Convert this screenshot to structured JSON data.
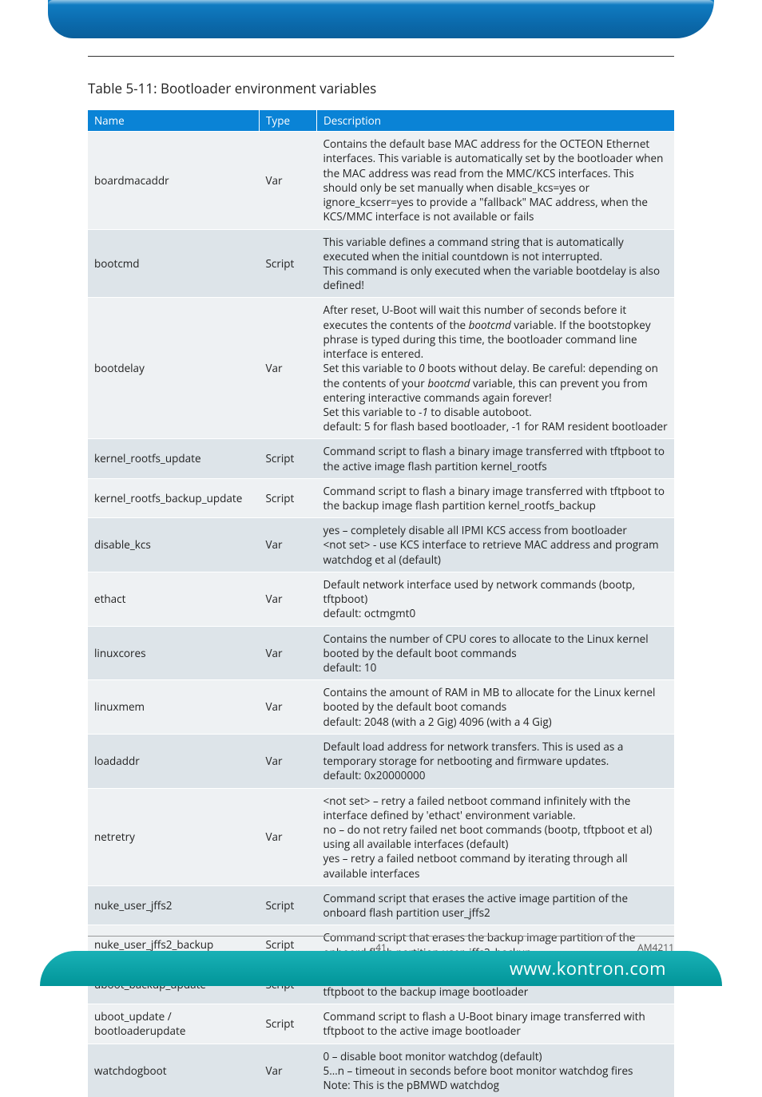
{
  "table": {
    "title": "Table 5-11: Bootloader environment variables",
    "headers": {
      "name": "Name",
      "type": "Type",
      "desc": "Description"
    },
    "rows": [
      {
        "name": "boardmacaddr",
        "type": "Var",
        "desc": "Contains the default base MAC address for the OCTEON Ethernet interfaces. This variable is automatically set by the bootloader when the MAC address was read from the MMC/KCS interfaces. This should only be set manually when disable_kcs=yes or ignore_kcserr=yes to provide a \"fallback\" MAC address, when the KCS/MMC interface is not available or fails"
      },
      {
        "name": "bootcmd",
        "type": "Script",
        "desc": "This variable defines a command string that is automatically executed when the initial countdown is not interrupted.\nThis command is only executed when the variable bootdelay is also defined!"
      },
      {
        "name": "bootdelay",
        "type": "Var",
        "desc": "After reset, U-Boot will wait this number of seconds before it executes the contents of the <i>bootcmd</i> variable. If the bootstopkey phrase is typed during this time, the bootloader command line interface is entered.\nSet this variable to <i>0</i> boots without delay. Be careful: depending on the contents of your <i>bootcmd</i> variable, this can prevent you from entering interactive commands again forever!\nSet this variable to <i>-1</i> to disable autoboot.\ndefault: 5 for flash based bootloader, -1 for RAM resident bootloader"
      },
      {
        "name": "kernel_rootfs_update",
        "type": "Script",
        "desc": "Command script to flash a  binary image transferred with tftpboot to the active image flash partition kernel_rootfs"
      },
      {
        "name": "kernel_rootfs_backup_update",
        "type": "Script",
        "desc": "Command script to flash a  binary image transferred with tftpboot to the backup image flash partition kernel_rootfs_backup"
      },
      {
        "name": "disable_kcs",
        "type": "Var",
        "desc": "yes – completely disable all IPMI KCS access from bootloader\n<not set> - use KCS interface to retrieve MAC address and program watchdog et al (default)"
      },
      {
        "name": "ethact",
        "type": "Var",
        "desc": "Default network interface used by network commands (bootp, tftpboot)\ndefault: octmgmt0"
      },
      {
        "name": "linuxcores",
        "type": "Var",
        "desc": "Contains the number of CPU cores to allocate to the Linux kernel booted by the default boot commands\ndefault: 10"
      },
      {
        "name": "linuxmem",
        "type": "Var",
        "desc": "Contains the amount of RAM in MB to allocate for the Linux kernel booted by the default boot comands\ndefault: 2048 (with a 2 Gig) 4096 (with a 4 Gig)"
      },
      {
        "name": "loadaddr",
        "type": "Var",
        "desc": "Default load address for network transfers. This is used as a temporary storage for netbooting and firmware updates.\ndefault: 0x20000000"
      },
      {
        "name": "netretry",
        "type": "Var",
        "desc": "<not set> – retry a failed netboot command infinitely with the interface defined by 'ethact' environment variable.\nno – do not retry failed net boot commands (bootp, tftpboot et al) using all available interfaces (default)\nyes – retry a failed netboot command by iterating through all available interfaces"
      },
      {
        "name": "nuke_user_jffs2",
        "type": "Script",
        "desc": "Command script that erases the active image partition of the onboard flash partition user_jffs2"
      },
      {
        "name": "nuke_user_jffs2_backup",
        "type": "Script",
        "desc": "Command script that erases the backup image partition of the onboard flash partition user_jffs2_backup"
      },
      {
        "name": "uboot_backup_update",
        "type": "Script",
        "desc": "Command script to flash a U-Boot binary image transferred with tftpboot to the backup image bootloader"
      },
      {
        "name": "uboot_update / bootloaderupdate",
        "type": "Script",
        "desc": "Command script to flash a U-Boot binary image transferred with tftpboot to the active image bootloader"
      },
      {
        "name": "watchdogboot",
        "type": "Var",
        "desc": "0 – disable boot monitor watchdog (default)\n5…n – timeout in seconds before boot monitor watchdog fires\nNote: This is the pBMWD watchdog"
      }
    ]
  },
  "footer": {
    "page": "41",
    "model": "AM4211",
    "site": "www.kontron.com"
  }
}
